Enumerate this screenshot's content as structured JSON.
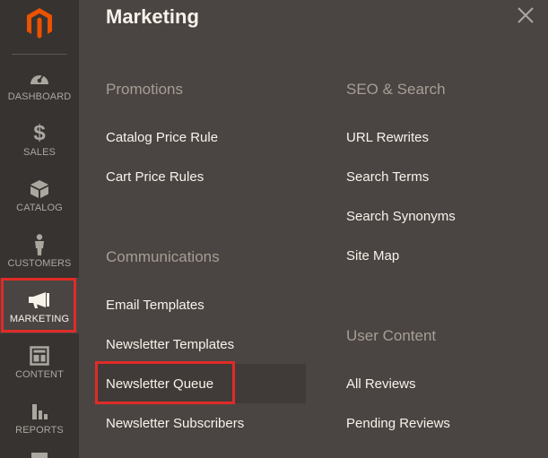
{
  "sidebar": {
    "logo": "magento-logo",
    "items": [
      {
        "key": "dashboard",
        "label": "DASHBOARD",
        "icon": "speedometer-icon"
      },
      {
        "key": "sales",
        "label": "SALES",
        "icon": "dollar-icon"
      },
      {
        "key": "catalog",
        "label": "CATALOG",
        "icon": "box-icon"
      },
      {
        "key": "customers",
        "label": "CUSTOMERS",
        "icon": "person-icon"
      },
      {
        "key": "marketing",
        "label": "MARKETING",
        "icon": "megaphone-icon",
        "active": true
      },
      {
        "key": "content",
        "label": "CONTENT",
        "icon": "layout-icon"
      },
      {
        "key": "reports",
        "label": "REPORTS",
        "icon": "bar-chart-icon"
      }
    ]
  },
  "panel": {
    "title": "Marketing",
    "close_icon": "close-icon",
    "columns": [
      {
        "sections": [
          {
            "title": "Promotions",
            "links": [
              "Catalog Price Rule",
              "Cart Price Rules"
            ]
          },
          {
            "title": "Communications",
            "links": [
              "Email Templates",
              "Newsletter Templates",
              "Newsletter Queue",
              "Newsletter Subscribers"
            ]
          }
        ]
      },
      {
        "sections": [
          {
            "title": "SEO & Search",
            "links": [
              "URL Rewrites",
              "Search Terms",
              "Search Synonyms",
              "Site Map"
            ]
          },
          {
            "title": "User Content",
            "links": [
              "All Reviews",
              "Pending Reviews"
            ]
          }
        ]
      }
    ]
  },
  "colors": {
    "sidebar_bg": "#373330",
    "panel_bg": "#4a4542",
    "logo_orange": "#eb5202",
    "highlight_red": "#e02b27"
  }
}
